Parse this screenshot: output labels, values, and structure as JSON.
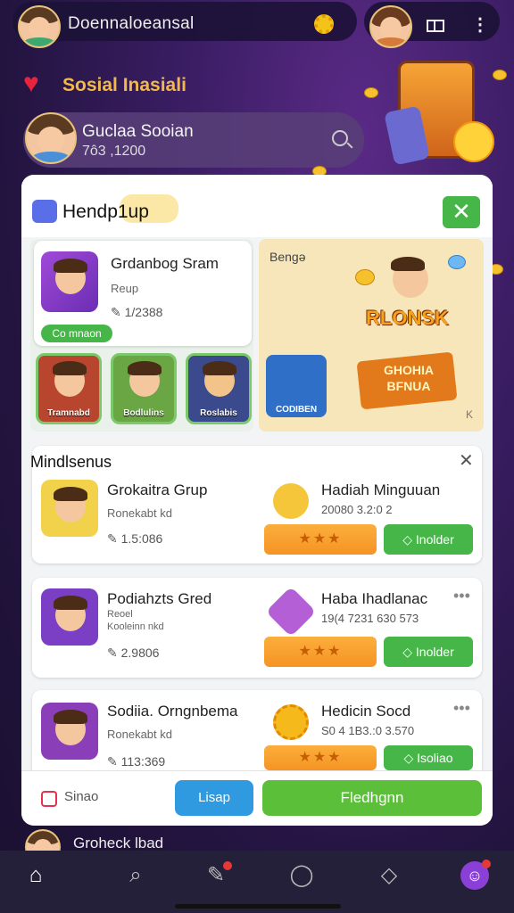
{
  "topbar": {
    "title": "Doennaloeansal"
  },
  "banner": {
    "title": "Sosial Inasiali"
  },
  "profile": {
    "name": "Guclaa Sooian",
    "number": "7ô3 ,1200"
  },
  "card": {
    "title": "Hendp1up",
    "featured": {
      "name": "Grdanbog Sram",
      "sub": "Reup",
      "count": "✎ 1/2388",
      "tag": "Co mnaon",
      "thumbs": [
        {
          "label": "Tramnabd"
        },
        {
          "label": "Bodlulins"
        },
        {
          "label": "Roslabis"
        }
      ]
    },
    "promo": {
      "label": "Bengə",
      "logo1": "RLONSK",
      "chest_label": "CODIBEN",
      "logo2": "GHOHIA\nBFNUA",
      "corner": "K"
    },
    "list": {
      "title": "Mindlsenus",
      "rows": [
        {
          "title": "Grokaitra Grup",
          "sub": "Ronekabt kd",
          "count": "✎ 1.5:086",
          "right_title": "Hadiah Minguuan",
          "right_sub": "20080 3.2:0 2",
          "rate": "★★★",
          "go": "◇ Inolder"
        },
        {
          "title": "Podiahzts Gred",
          "sub": "Reoel\nKooleinn nkd",
          "count": "✎ 2.9806",
          "right_title": "Haba Ihadlanac",
          "right_sub": "19(4 7231 630 573",
          "rate": "★★★",
          "go": "◇ Inolder"
        },
        {
          "title": "Sodiia. Orngnbema",
          "sub": "Ronekabt kd",
          "count": "✎ 113:369",
          "right_title": "Hedicin Socd",
          "right_sub": "S0 4 1B3.:0 3.570",
          "rate": "★★★",
          "go": "◇ Isoliao"
        }
      ]
    },
    "footer": {
      "label": "Sinao",
      "blue_btn": "Lisap",
      "green_btn": "Fledhgnn"
    }
  },
  "bottom_user": {
    "name": "Groheck lbad"
  },
  "nav": {
    "items": [
      "home-icon",
      "search-icon",
      "edit-icon",
      "chat-icon",
      "message-icon",
      "profile-icon"
    ]
  },
  "colors": {
    "accent_green": "#46b649",
    "accent_orange": "#f59424",
    "bg_purple": "#3a1d63"
  }
}
